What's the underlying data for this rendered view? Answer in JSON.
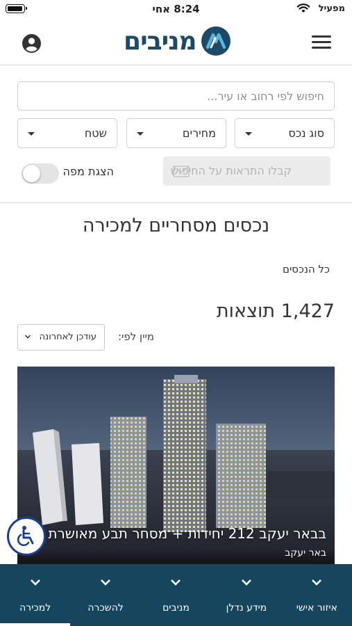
{
  "status_bar": {
    "time": "8:24 אחי",
    "carrier": "מפעיל"
  },
  "header": {
    "logo_text": "מניבים"
  },
  "search": {
    "placeholder": "חיפוש לפי רחוב או עיר..."
  },
  "filters": {
    "property_type": "סוג נכס",
    "prices": "מחירים",
    "area": "שטח"
  },
  "alerts": {
    "label": "קבלו התראות על החיפוש"
  },
  "map_toggle": {
    "label": "הצגת מפה",
    "on": false
  },
  "page": {
    "title": "נכסים מסחריים למכירה",
    "all_properties": "כל הנכסים",
    "results_count": "1,427 תוצאות",
    "sort_label": "מיין לפי:",
    "sort_value": "עודכן לאחרונה"
  },
  "listing": {
    "title": "בבאר יעקב 212 יחידות + מסחר תבע מאושרת",
    "city": "באר יעקב"
  },
  "bottom_nav": {
    "items": [
      {
        "label": "איזור אישי",
        "active": false
      },
      {
        "label": "מידע נדלן",
        "active": false
      },
      {
        "label": "מניבים",
        "active": false
      },
      {
        "label": "להשכרה",
        "active": false
      },
      {
        "label": "למכירה",
        "active": true
      }
    ]
  },
  "colors": {
    "brand": "#1d4a66",
    "nav_bg": "#16465e",
    "accessibility": "#1b3e8e"
  },
  "icons": {
    "menu": "hamburger-icon",
    "account": "user-circle-icon",
    "alerts": "envelope-icon",
    "accessibility": "wheelchair-icon",
    "nav": "chevron-down-icon"
  }
}
